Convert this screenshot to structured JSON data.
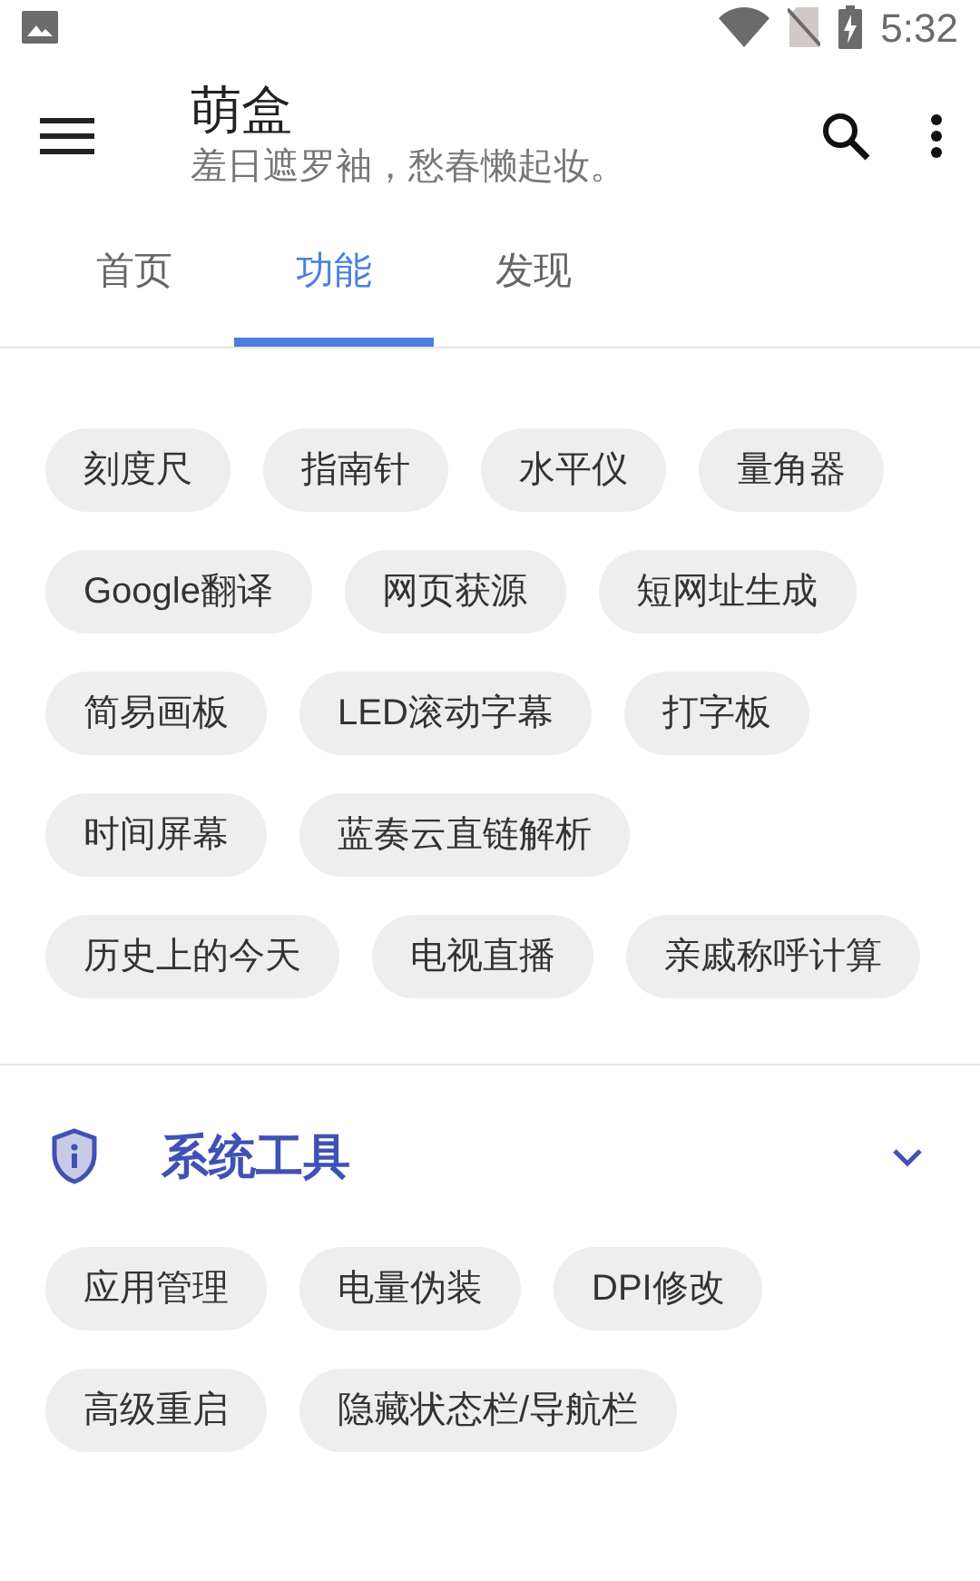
{
  "status_bar": {
    "time": "5:32"
  },
  "app_bar": {
    "title": "萌盒",
    "subtitle": "羞日遮罗袖，愁春懒起妆。"
  },
  "tabs": [
    {
      "label": "首页",
      "selected": false
    },
    {
      "label": "功能",
      "selected": true
    },
    {
      "label": "发现",
      "selected": false
    }
  ],
  "sections": [
    {
      "chips": [
        "刻度尺",
        "指南针",
        "水平仪",
        "量角器",
        "Google翻译",
        "网页获源",
        "短网址生成",
        "简易画板",
        "LED滚动字幕",
        "打字板",
        "时间屏幕",
        "蓝奏云直链解析",
        "历史上的今天",
        "电视直播",
        "亲戚称呼计算"
      ]
    },
    {
      "title": "系统工具",
      "chips": [
        "应用管理",
        "电量伪装",
        "DPI修改",
        "高级重启",
        "隐藏状态栏/导航栏"
      ]
    }
  ]
}
